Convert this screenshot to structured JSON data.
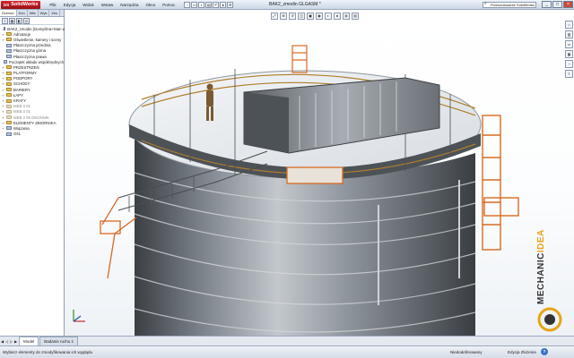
{
  "app": {
    "logo_ds": "DS",
    "logo_name": "SolidWorks",
    "document_title": "BAK2_zmodin GLGASM *"
  },
  "menu": [
    "Plik",
    "Edycja",
    "Widok",
    "Wstaw",
    "Narzędzia",
    "Okno",
    "Pomoc"
  ],
  "quick_access": [
    "new-icon",
    "open-icon",
    "save-icon",
    "print-icon",
    "undo-icon",
    "rebuild-icon",
    "options-icon"
  ],
  "search": {
    "value": "Przeszukiwanie SolidWorks"
  },
  "window_controls": {
    "minimize": "_",
    "restore": "□",
    "close": "×"
  },
  "panel": {
    "tabs": [
      "Drzewo",
      "Kon",
      "Wła",
      "Wyś",
      "Zes"
    ],
    "toolbar_icons": [
      "feature-manager-icon",
      "property-manager-icon",
      "configuration-icon",
      "dim-expert-icon"
    ],
    "root": "BAK2_zmodin (Domyślna<Stan wyświe",
    "items": [
      {
        "label": "Adnotacje",
        "type": "folder",
        "expand": "+"
      },
      {
        "label": "Oświetlenie, kamery i sceny",
        "type": "folder",
        "expand": "+"
      },
      {
        "label": "Płaszczyzna przednia",
        "type": "plane",
        "expand": ""
      },
      {
        "label": "Płaszczyzna górna",
        "type": "plane",
        "expand": ""
      },
      {
        "label": "Płaszczyzna prawa",
        "type": "plane",
        "expand": ""
      },
      {
        "label": "Początek układu współrzędnych",
        "type": "origin",
        "expand": ""
      },
      {
        "label": "PRZESTRZEŃ",
        "type": "folder",
        "expand": "+"
      },
      {
        "label": "PLATFORMY",
        "type": "folder",
        "expand": "+"
      },
      {
        "label": "PODPORY",
        "type": "folder",
        "expand": "+"
      },
      {
        "label": "SCHODY",
        "type": "folder",
        "expand": "+"
      },
      {
        "label": "BARIERY",
        "type": "folder",
        "expand": "+"
      },
      {
        "label": "ŁAPY",
        "type": "folder",
        "expand": "+"
      },
      {
        "label": "KRATY",
        "type": "folder",
        "expand": "+"
      },
      {
        "label": "MEB 3 01",
        "type": "folder-grey",
        "expand": "+"
      },
      {
        "label": "MEB 3 01",
        "type": "folder-grey",
        "expand": "+"
      },
      {
        "label": "MEB 3 05 OKONNIK",
        "type": "folder-grey",
        "expand": "+"
      },
      {
        "label": "ELEMENTY ZBIORNIKA",
        "type": "folder",
        "expand": "+"
      },
      {
        "label": "Wiązania",
        "type": "mates",
        "expand": "+"
      },
      {
        "label": "Oś1",
        "type": "axis",
        "expand": ""
      }
    ]
  },
  "viewport": {
    "top_tools": [
      "zoom-fit-icon",
      "zoom-area-icon",
      "previous-view-icon",
      "section-view-icon",
      "view-orientation-icon",
      "display-style-icon",
      "hide-show-icon",
      "edit-appearance-icon",
      "apply-scene-icon",
      "view-settings-icon"
    ],
    "right_tools": [
      "resources-icon",
      "design-library-icon",
      "file-explorer-icon",
      "view-palette-icon",
      "appearances-icon",
      "custom-properties-icon"
    ]
  },
  "brand": {
    "part1": "MECHANIC",
    "part2": "IDEA"
  },
  "model_tabs": {
    "tabs": [
      "Model",
      "Badanie ruchu 1"
    ],
    "active": 0
  },
  "status": {
    "message": "Wybierz elementy do zmodyfikowania ich wyglądu",
    "state": "Niedodefiniowany",
    "mode": "Edycja Złożenia",
    "help": "?"
  },
  "colors": {
    "tank_body": "#6f767d",
    "stair_orange": "#d86a22",
    "brand_accent": "#e8a317",
    "logo_red": "#c81e25"
  }
}
